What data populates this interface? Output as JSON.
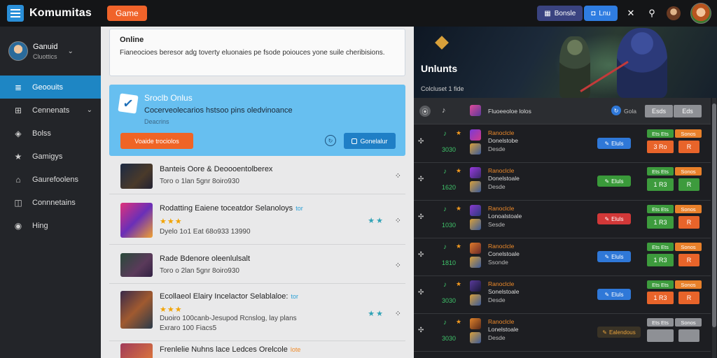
{
  "app": {
    "title": "Komumitas",
    "badge": "Game"
  },
  "topbar": {
    "btn1": "Bonsle",
    "btn2": "Lnu"
  },
  "profile": {
    "name": "Ganuid",
    "status": "Cluottics"
  },
  "sidebar": {
    "items": [
      {
        "label": "Geoouits",
        "icon": "≣",
        "icon_name": "list-icon"
      },
      {
        "label": "Cennenats",
        "icon": "⊞",
        "icon_name": "grid-icon"
      },
      {
        "label": "Bolss",
        "icon": "◈",
        "icon_name": "badge-icon"
      },
      {
        "label": "Gamigys",
        "icon": "★",
        "icon_name": "star-icon"
      },
      {
        "label": "Gaurefoolens",
        "icon": "⌂",
        "icon_name": "home-icon"
      },
      {
        "label": "Connnetains",
        "icon": "◫",
        "icon_name": "panel-icon"
      },
      {
        "label": "Hing",
        "icon": "◉",
        "icon_name": "target-icon"
      }
    ]
  },
  "online_card": {
    "title": "Online",
    "text": "Fianeocioes beresor adg toverty eluonaies pe fsode poiouces yone suile cheribisions."
  },
  "blue_card": {
    "title": "Sroclb Onlus",
    "text": "Cocerveolecarios hstsoo pins oledvinoance",
    "sub": "Deacrins",
    "orange_btn": "Voaide trociolos",
    "blue_btn": "Gonelalur"
  },
  "feed": [
    {
      "title": "Banteis Oore & Deoooentolberex",
      "tag": "",
      "tag_color": "",
      "stars": "",
      "meta": "Toro o 1lan 5gnr 8oiro930",
      "meta2": "",
      "teal": ""
    },
    {
      "title": "Rodatting Eaiene toceatdor Selanoloys",
      "tag": "tor",
      "tag_color": "blue",
      "stars": "★★★",
      "meta": "Dyelo 1o1 Eat 68o933 13990",
      "meta2": "",
      "teal": "★★"
    },
    {
      "title": "Rade Bdenore oleenlulsalt",
      "tag": "",
      "tag_color": "",
      "stars": "",
      "meta": "Toro o 2lan 5gnr 8oiro930",
      "meta2": "",
      "teal": ""
    },
    {
      "title": "Ecollaeol Elairy Incelactor Selablaloe:",
      "tag": "tor",
      "tag_color": "blue",
      "stars": "★★★",
      "meta": "Duoiro 100canb-Jesupod Rcnslog, lay plans",
      "meta2": "Exraro 100 Fiacs5",
      "teal": "★★"
    },
    {
      "title": "Frenlelie Nuhns lace Ledces Orelcole",
      "tag": "lote",
      "tag_color": "orange",
      "stars": "",
      "meta": "",
      "meta2": "",
      "teal": ""
    }
  ],
  "hero": {
    "title": "Unlunts",
    "subtitle": "Colcluset 1 fide"
  },
  "right_header": {
    "name": "Fluoeeoloe lolos",
    "status": "Gola",
    "btn1": "Esds",
    "btn2": "Eds"
  },
  "right_rows": [
    {
      "num": "3030",
      "name1": "Ranoclcle",
      "name2": "Donelstobe",
      "name3": "Desde",
      "pill": "Eluls",
      "pill_color": "blue",
      "m1": "Ets Ets",
      "m2": "Sonos",
      "b1": "3 Ro",
      "b2": "R",
      "b1c": "o",
      "b2c": "o"
    },
    {
      "num": "1620",
      "name1": "Ranoclcle",
      "name2": "Donelstoale",
      "name3": "Desde",
      "pill": "Eluls",
      "pill_color": "green",
      "m1": "Ets Ets",
      "m2": "Sonos",
      "b1": "1 R3",
      "b2": "R",
      "b1c": "g",
      "b2c": "g"
    },
    {
      "num": "1030",
      "name1": "Ranoclcle",
      "name2": "Lonoalstoale",
      "name3": "Sesde",
      "pill": "Eluls",
      "pill_color": "red",
      "m1": "Ets Ets",
      "m2": "Sonos",
      "b1": "1 R3",
      "b2": "R",
      "b1c": "g",
      "b2c": "o"
    },
    {
      "num": "1810",
      "name1": "Ranoclcle",
      "name2": "Conelstoale",
      "name3": "Ssonde",
      "pill": "Eluls",
      "pill_color": "blue",
      "m1": "Ets Ets",
      "m2": "Sonos",
      "b1": "1 R3",
      "b2": "R",
      "b1c": "g",
      "b2c": "o"
    },
    {
      "num": "3030",
      "name1": "Ranoclcle",
      "name2": "Sonelstoale",
      "name3": "Desde",
      "pill": "Eluls",
      "pill_color": "blue",
      "m1": "Ets Ets",
      "m2": "Sonos",
      "b1": "1 R3",
      "b2": "R",
      "b1c": "o",
      "b2c": "o"
    },
    {
      "num": "3030",
      "name1": "Ranoclcle",
      "name2": "Lonelstoale",
      "name3": "Desde",
      "pill": "Ealendous",
      "pill_color": "dark",
      "m1": "Ets Ets",
      "m2": "Sonos",
      "b1": "",
      "b2": "",
      "b1c": "gray",
      "b2c": "gray"
    }
  ],
  "colors": {
    "accent": "#1e86c4",
    "orange": "#ef6426",
    "green": "#3fc46a",
    "card_blue": "#67bff0"
  }
}
